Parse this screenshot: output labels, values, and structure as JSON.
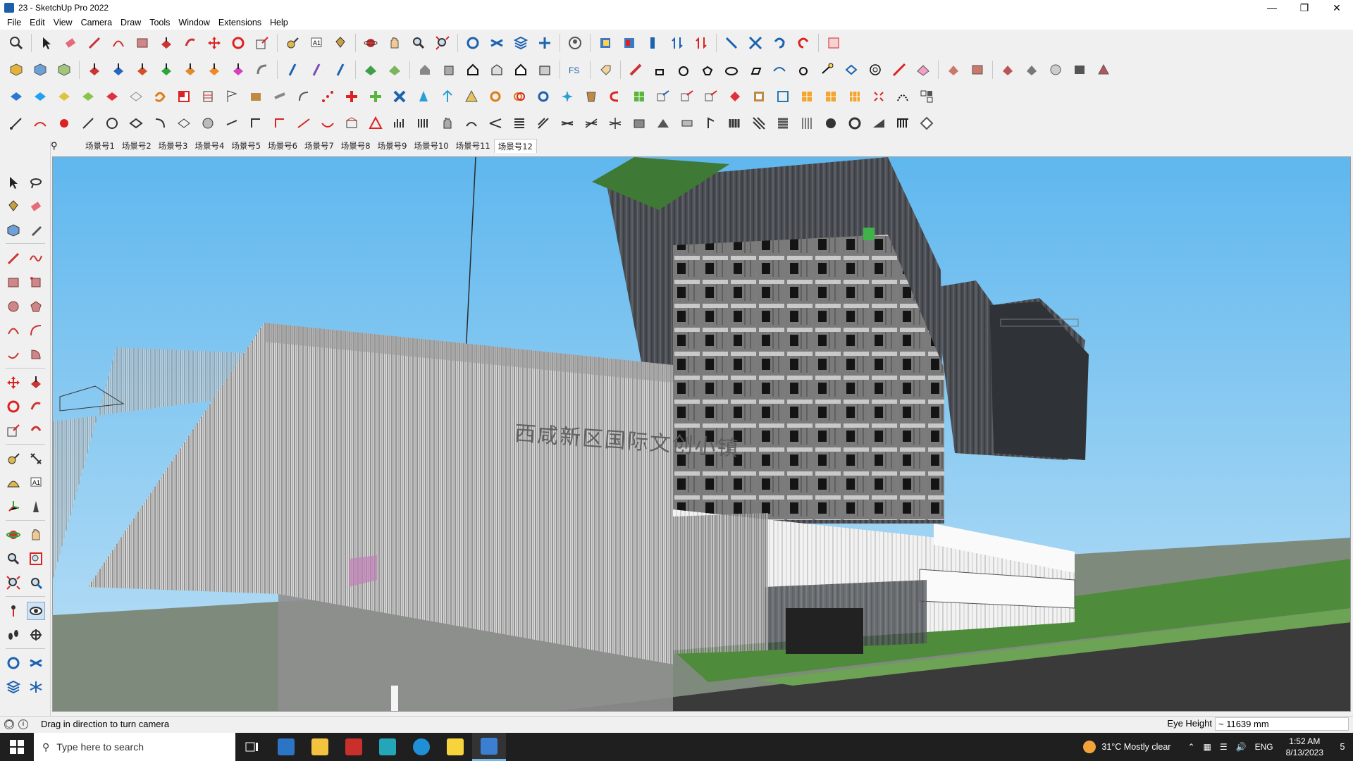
{
  "window": {
    "title": "23 - SketchUp Pro 2022"
  },
  "menu": [
    "File",
    "Edit",
    "View",
    "Camera",
    "Draw",
    "Tools",
    "Window",
    "Extensions",
    "Help"
  ],
  "scenes": {
    "tabs": [
      "场景号1",
      "场景号2",
      "场景号3",
      "场景号4",
      "场景号5",
      "场景号6",
      "场景号7",
      "场景号8",
      "场景号9",
      "场景号10",
      "场景号11",
      "场景号12"
    ],
    "active": "场景号12"
  },
  "viewport": {
    "building_sign": "西咸新区国际文创小镇"
  },
  "status": {
    "hint": "Drag in direction to turn camera",
    "measure_label": "Eye Height",
    "measure_value": "~ 11639 mm"
  },
  "taskbar": {
    "search_placeholder": "Type here to search",
    "weather": "31°C  Mostly clear",
    "language": "ENG",
    "time": "1:52 AM",
    "date": "8/13/2023",
    "notification_count": "5"
  },
  "colors": {
    "sky": "#6cbcef",
    "grass": "#4e8b3a",
    "road": "#3a3a3a",
    "accent_taskbar": "#76b9ed"
  }
}
